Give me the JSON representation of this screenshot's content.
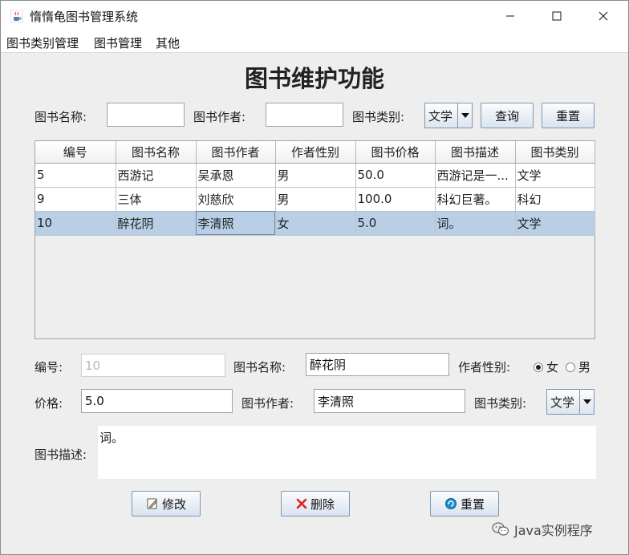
{
  "window": {
    "title": "惰惰龟图书管理系统",
    "controls": {
      "minimize": "─",
      "maximize": "☐",
      "close": "✕"
    }
  },
  "menu": [
    "图书类别管理",
    "图书管理",
    "其他"
  ],
  "page_title": "图书维护功能",
  "search": {
    "name_label": "图书名称:",
    "name_value": "",
    "author_label": "图书作者:",
    "author_value": "",
    "type_label": "图书类别:",
    "type_value": "文学",
    "query_button": "查询",
    "reset_button": "重置"
  },
  "table": {
    "columns": [
      "编号",
      "图书名称",
      "图书作者",
      "作者性别",
      "图书价格",
      "图书描述",
      "图书类别"
    ],
    "rows": [
      [
        "5",
        "西游记",
        "吴承恩",
        "男",
        "50.0",
        "西游记是一...",
        "文学"
      ],
      [
        "9",
        "三体",
        "刘慈欣",
        "男",
        "100.0",
        "科幻巨著。",
        "科幻"
      ],
      [
        "10",
        "醉花阴",
        "李清照",
        "女",
        "5.0",
        "词。",
        "文学"
      ]
    ],
    "selected_row": 2
  },
  "form": {
    "id_label": "编号:",
    "id_value": "10",
    "name_label": "图书名称:",
    "name_value": "醉花阴",
    "sex_label": "作者性别:",
    "sex_options": [
      "女",
      "男"
    ],
    "sex_selected": "女",
    "price_label": "价格:",
    "price_value": "5.0",
    "author_label": "图书作者:",
    "author_value": "李清照",
    "type_label": "图书类别:",
    "type_value": "文学",
    "desc_label": "图书描述:",
    "desc_value": "词。"
  },
  "actions": {
    "modify": "修改",
    "delete": "删除",
    "reset": "重置"
  },
  "watermark": "Java实例程序",
  "colors": {
    "selection": "#b8cfe5",
    "delete_icon": "#e02020",
    "reset_icon": "#1a8fd0"
  }
}
